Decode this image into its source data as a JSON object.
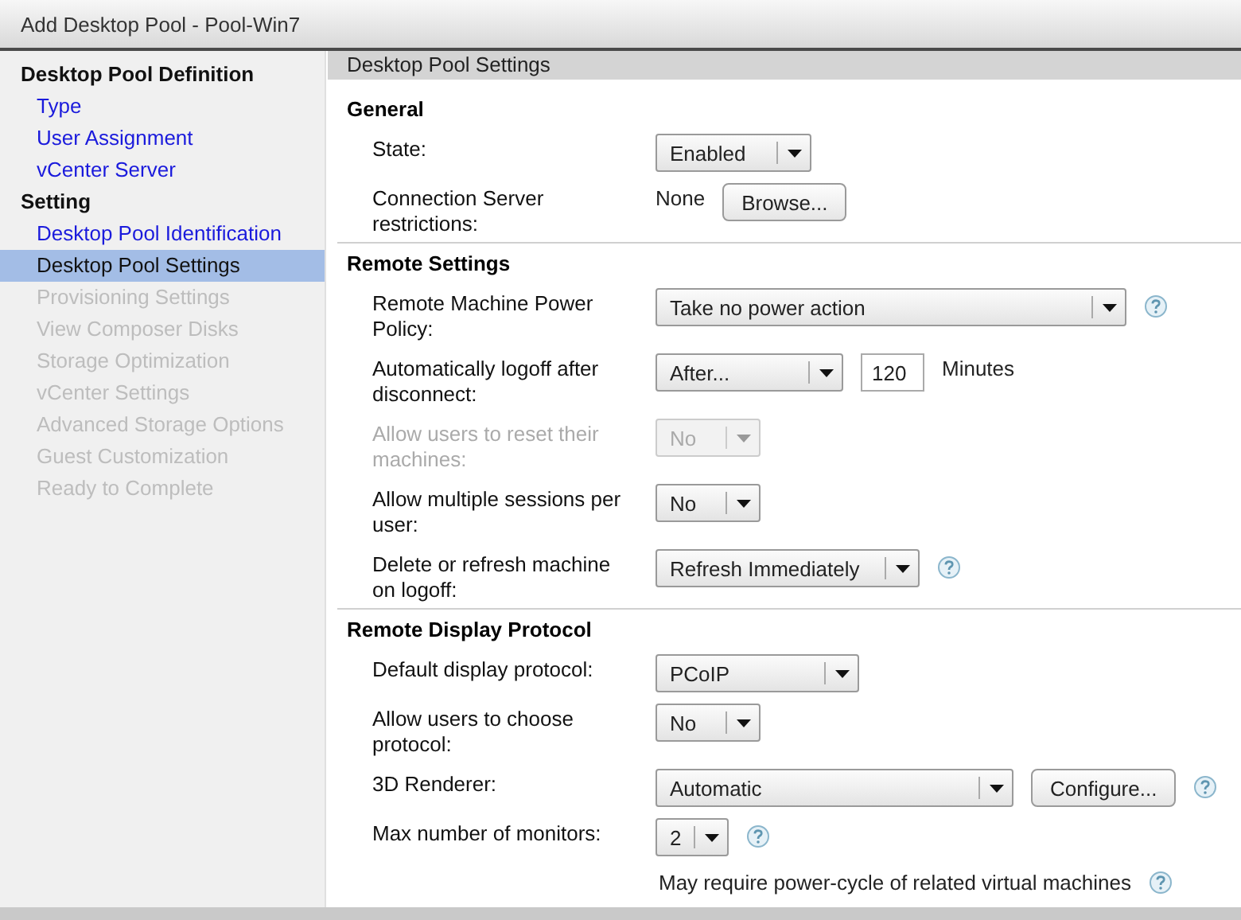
{
  "window": {
    "title": "Add Desktop Pool - Pool-Win7"
  },
  "sidebar": {
    "items": [
      {
        "kind": "heading",
        "label": "Desktop Pool Definition"
      },
      {
        "kind": "step",
        "label": "Type",
        "selected": false,
        "disabled": false
      },
      {
        "kind": "step",
        "label": "User Assignment",
        "selected": false,
        "disabled": false
      },
      {
        "kind": "step",
        "label": "vCenter Server",
        "selected": false,
        "disabled": false
      },
      {
        "kind": "heading",
        "label": "Setting"
      },
      {
        "kind": "step",
        "label": "Desktop Pool Identification",
        "selected": false,
        "disabled": false
      },
      {
        "kind": "step",
        "label": "Desktop Pool Settings",
        "selected": true,
        "disabled": false
      },
      {
        "kind": "step",
        "label": "Provisioning Settings",
        "selected": false,
        "disabled": true
      },
      {
        "kind": "step",
        "label": "View Composer Disks",
        "selected": false,
        "disabled": true
      },
      {
        "kind": "step",
        "label": "Storage Optimization",
        "selected": false,
        "disabled": true
      },
      {
        "kind": "step",
        "label": "vCenter Settings",
        "selected": false,
        "disabled": true
      },
      {
        "kind": "step",
        "label": "Advanced Storage Options",
        "selected": false,
        "disabled": true
      },
      {
        "kind": "step",
        "label": "Guest Customization",
        "selected": false,
        "disabled": true
      },
      {
        "kind": "step",
        "label": "Ready to Complete",
        "selected": false,
        "disabled": true
      }
    ]
  },
  "panel": {
    "title": "Desktop Pool Settings",
    "sections": [
      {
        "title": "General",
        "rows": [
          {
            "label": "State:",
            "disabled": false,
            "controls": [
              {
                "kind": "dropdown",
                "value": "Enabled"
              }
            ]
          },
          {
            "label": "Connection Server restrictions:",
            "disabled": false,
            "controls": [
              {
                "kind": "text",
                "text": "None"
              },
              {
                "kind": "button",
                "label": "Browse..."
              }
            ]
          }
        ]
      },
      {
        "title": "Remote Settings",
        "rows": [
          {
            "label": "Remote Machine Power Policy:",
            "disabled": false,
            "controls": [
              {
                "kind": "dropdown",
                "value": "Take no power action"
              },
              {
                "kind": "help"
              }
            ]
          },
          {
            "label": "Automatically logoff after disconnect:",
            "disabled": false,
            "controls": [
              {
                "kind": "dropdown",
                "value": "After..."
              },
              {
                "kind": "input",
                "value": "120"
              },
              {
                "kind": "text",
                "text": "Minutes"
              }
            ]
          },
          {
            "label": "Allow users to reset their machines:",
            "disabled": true,
            "controls": [
              {
                "kind": "dropdown",
                "value": "No"
              }
            ]
          },
          {
            "label": "Allow multiple sessions per user:",
            "disabled": false,
            "controls": [
              {
                "kind": "dropdown",
                "value": "No"
              }
            ]
          },
          {
            "label": "Delete or refresh machine on logoff:",
            "disabled": false,
            "controls": [
              {
                "kind": "dropdown",
                "value": "Refresh Immediately"
              },
              {
                "kind": "help"
              }
            ]
          }
        ]
      },
      {
        "title": "Remote Display Protocol",
        "rows": [
          {
            "label": "Default display protocol:",
            "disabled": false,
            "controls": [
              {
                "kind": "dropdown",
                "value": "PCoIP"
              }
            ]
          },
          {
            "label": "Allow users to choose protocol:",
            "disabled": false,
            "controls": [
              {
                "kind": "dropdown",
                "value": "No"
              }
            ]
          },
          {
            "label": "3D Renderer:",
            "disabled": false,
            "controls": [
              {
                "kind": "dropdown",
                "value": "Automatic"
              },
              {
                "kind": "button",
                "label": "Configure..."
              },
              {
                "kind": "help"
              }
            ]
          },
          {
            "label": "Max number of monitors:",
            "disabled": false,
            "controls": [
              {
                "kind": "dropdown",
                "value": "2"
              },
              {
                "kind": "help"
              }
            ]
          },
          {
            "controls": [
              {
                "kind": "note",
                "text": "May require power-cycle of related virtual machines"
              },
              {
                "kind": "help"
              }
            ]
          }
        ]
      }
    ]
  }
}
